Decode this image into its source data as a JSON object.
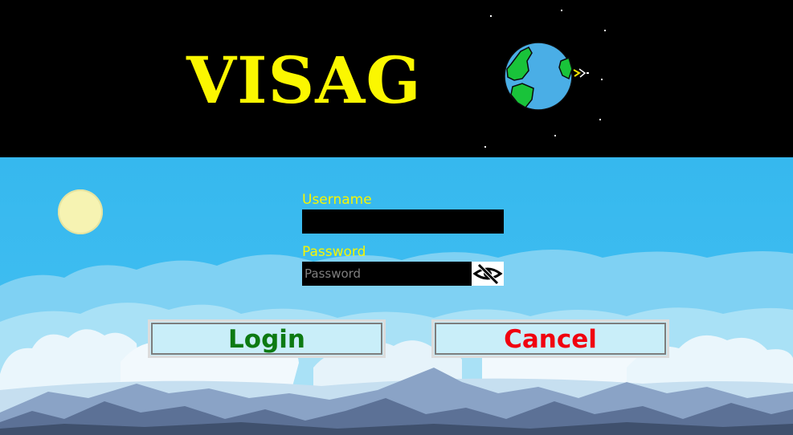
{
  "app": {
    "title": "VISAG"
  },
  "login_form": {
    "username_label": "Username",
    "username_value": "",
    "password_label": "Password",
    "password_value": "",
    "password_placeholder": "Password"
  },
  "buttons": {
    "login_label": "Login",
    "cancel_label": "Cancel"
  },
  "icons": {
    "logo": "globe-icon",
    "password_toggle": "eye-slash-icon",
    "sun": "sun-icon"
  },
  "colors": {
    "title": "#fbf700",
    "label": "#f7f500",
    "login_text": "#0d7a12",
    "cancel_text": "#f0000f",
    "sky": "#3dbcf0"
  }
}
